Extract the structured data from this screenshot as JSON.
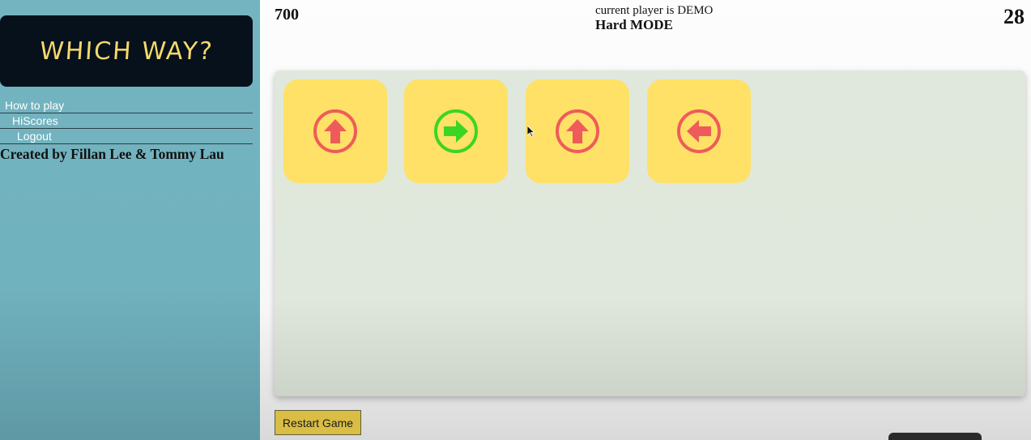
{
  "sidebar": {
    "logo": "WHICH WAY?",
    "nav": [
      {
        "label": "How to play"
      },
      {
        "label": "HiScores"
      },
      {
        "label": "Logout"
      }
    ],
    "credits": "Created by Fillan Lee & Tommy Lau"
  },
  "header": {
    "score": "700",
    "player": "current player is DEMO",
    "mode": "Hard MODE",
    "timer": "28"
  },
  "board": {
    "cards": [
      {
        "direction": "up",
        "icon": "arrow-up-circle-icon",
        "color": "#ef5b5b"
      },
      {
        "direction": "right",
        "icon": "arrow-right-circle-icon",
        "color": "#3bd523"
      },
      {
        "direction": "up",
        "icon": "arrow-up-circle-icon",
        "color": "#ef5b5b"
      },
      {
        "direction": "left",
        "icon": "arrow-left-circle-icon",
        "color": "#ef5b5b"
      }
    ],
    "card_color": "#fee166",
    "board_color": "#e0e8dd"
  },
  "footer": {
    "restart_label": "Restart Game",
    "restart_color": "#d9bd45"
  }
}
